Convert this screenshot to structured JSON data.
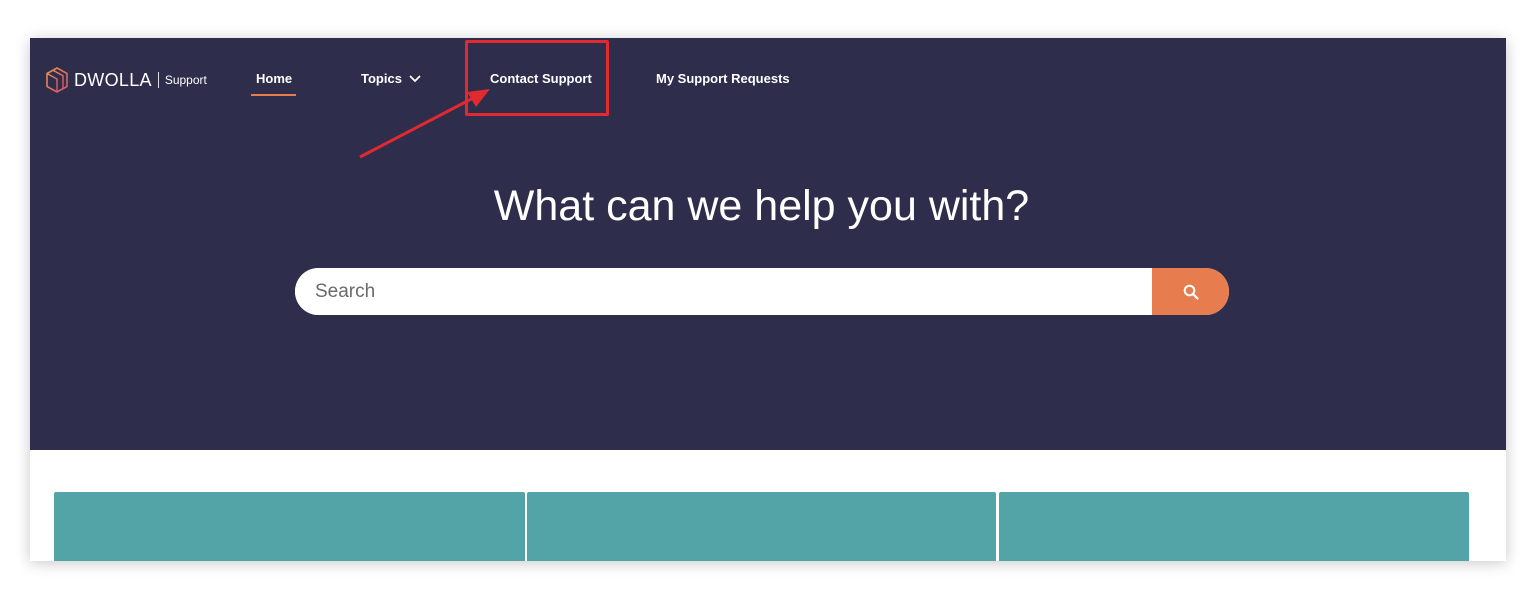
{
  "brand": {
    "name": "DWOLLA",
    "section": "Support",
    "accent_color": "#e77d4f"
  },
  "nav": {
    "home": "Home",
    "topics": "Topics",
    "contact_support": "Contact Support",
    "my_requests": "My Support Requests"
  },
  "hero": {
    "headline": "What can we help you with?",
    "background": "#2e2d4b"
  },
  "search": {
    "placeholder": "Search",
    "button_icon": "search-icon",
    "button_color": "#e77d4f"
  },
  "cards": [
    {
      "color": "#52a4a6"
    },
    {
      "color": "#52a4a6"
    },
    {
      "color": "#52a4a6"
    }
  ],
  "annotation": {
    "color": "#e02a2f",
    "target": "Contact Support"
  }
}
